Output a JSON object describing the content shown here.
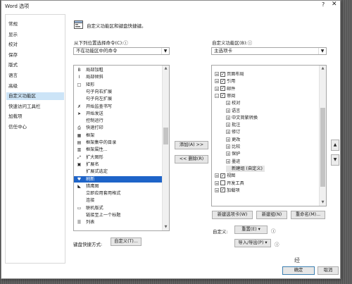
{
  "dialog": {
    "title": "Word 选项",
    "help": "?",
    "close": "✕"
  },
  "nav": {
    "items": [
      {
        "label": "常规"
      },
      {
        "label": "显示"
      },
      {
        "label": "校对"
      },
      {
        "label": "保存"
      },
      {
        "label": "版式"
      },
      {
        "label": "语言"
      },
      {
        "label": "高级"
      },
      {
        "label": "自定义功能区"
      },
      {
        "label": "快速访问工具栏"
      },
      {
        "label": "加载项"
      },
      {
        "label": "信任中心"
      }
    ],
    "selected_index": 7
  },
  "header": {
    "text": "自定义功能区和键盘快捷键。"
  },
  "left_panel": {
    "label": "从下列位置选择命令(C):",
    "info_icon": "ⓘ",
    "combo_value": "不在功能区中的命令",
    "items": [
      {
        "label": "局部加粗",
        "icon": "bold-partial-icon",
        "glyph": "B"
      },
      {
        "label": "局部倾斜",
        "icon": "italic-partial-icon",
        "glyph": "I"
      },
      {
        "label": "矩形",
        "icon": "rectangle-icon",
        "glyph": "□"
      },
      {
        "label": "句子向右扩展",
        "icon": "",
        "glyph": ""
      },
      {
        "label": "句子向左扩展",
        "icon": "",
        "glyph": ""
      },
      {
        "label": "开始监查书写",
        "icon": "spellcheck-icon",
        "glyph": "✗"
      },
      {
        "label": "开始发送",
        "icon": "send-icon",
        "glyph": "➤"
      },
      {
        "label": "控制运行",
        "icon": "",
        "glyph": ""
      },
      {
        "label": "快速打印",
        "icon": "print-icon",
        "glyph": "⎙"
      },
      {
        "label": "框架",
        "icon": "frame-icon",
        "glyph": "▦"
      },
      {
        "label": "框架集中的目录",
        "icon": "frame-toc-icon",
        "glyph": "▤"
      },
      {
        "label": "框架属性...",
        "icon": "frame-properties-icon",
        "glyph": "▥"
      },
      {
        "label": "扩大图形",
        "icon": "enlarge-icon",
        "glyph": "⤢"
      },
      {
        "label": "扩展名",
        "icon": "extension-icon",
        "glyph": "▣"
      },
      {
        "label": "扩展式选定",
        "icon": "",
        "glyph": ""
      },
      {
        "label": "刷新",
        "icon": "refresh-icon",
        "glyph": "♥"
      },
      {
        "label": "猎鹰图",
        "icon": "chart-icon",
        "glyph": "◣"
      },
      {
        "label": "立即应用套用格式",
        "icon": "",
        "glyph": ""
      },
      {
        "label": "连接",
        "icon": "",
        "glyph": ""
      },
      {
        "label": "联机版式",
        "icon": "online-layout-icon",
        "glyph": "▭"
      },
      {
        "label": "链接至上一个标题",
        "icon": "",
        "glyph": ""
      },
      {
        "label": "列表",
        "icon": "list-icon",
        "glyph": "☰"
      }
    ],
    "selected_index": 15
  },
  "middle_buttons": {
    "add": "添加(A) >>",
    "remove": "<< 删除(R)"
  },
  "right_panel": {
    "label": "自定义功能区(B):",
    "info_icon": "ⓘ",
    "combo_value": "主选项卡",
    "tree": [
      {
        "label": "页面布局",
        "level": 1,
        "expander": "+",
        "checked": true
      },
      {
        "label": "引用",
        "level": 1,
        "expander": "+",
        "checked": true
      },
      {
        "label": "邮件",
        "level": 1,
        "expander": "+",
        "checked": true
      },
      {
        "label": "审阅",
        "level": 1,
        "expander": "−",
        "checked": true
      },
      {
        "label": "校对",
        "level": 2,
        "expander": "+",
        "checked": null
      },
      {
        "label": "语言",
        "level": 2,
        "expander": "+",
        "checked": null
      },
      {
        "label": "中文简繁转换",
        "level": 2,
        "expander": "+",
        "checked": null
      },
      {
        "label": "批注",
        "level": 2,
        "expander": "+",
        "checked": null
      },
      {
        "label": "修订",
        "level": 2,
        "expander": "+",
        "checked": null
      },
      {
        "label": "更改",
        "level": 2,
        "expander": "+",
        "checked": null
      },
      {
        "label": "比较",
        "level": 2,
        "expander": "+",
        "checked": null
      },
      {
        "label": "保护",
        "level": 2,
        "expander": "+",
        "checked": null
      },
      {
        "label": "墨迹",
        "level": 2,
        "expander": "+",
        "checked": null
      },
      {
        "label": "新建组 (自定义)",
        "level": 2,
        "expander": "",
        "checked": null
      },
      {
        "label": "视图",
        "level": 1,
        "expander": "+",
        "checked": true
      },
      {
        "label": "开发工具",
        "level": 1,
        "expander": "+",
        "checked": false
      },
      {
        "label": "加载项",
        "level": 1,
        "expander": "+",
        "checked": true
      }
    ],
    "selected_index": 13,
    "buttons": {
      "new_tab": "新建选项卡(W)",
      "new_group": "新建组(N)",
      "rename": "重命名(M)..."
    },
    "customize_label": "自定义:",
    "reset": "重置(E) ▾",
    "import_export": "导入/导出(P) ▾"
  },
  "keyboard": {
    "label": "键盘快捷方式:",
    "button": "自定义(T)..."
  },
  "footer": {
    "ok": "确定",
    "cancel": "取消"
  },
  "updown": {
    "up": "▲",
    "down": "▼"
  }
}
